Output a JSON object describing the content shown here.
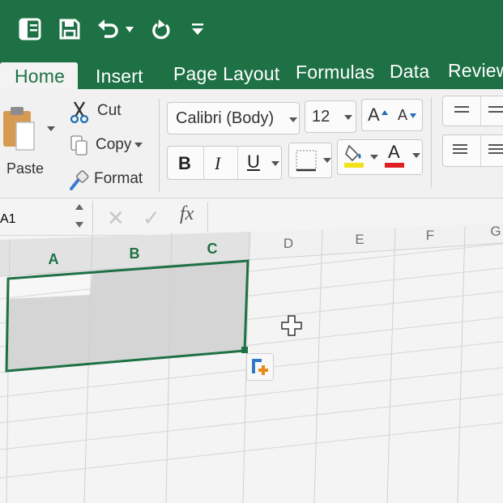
{
  "quick_access": {
    "icons": [
      "sidebar-toggle-icon",
      "save-icon",
      "undo-icon",
      "redo-icon",
      "customize-toolbar-icon"
    ]
  },
  "tabs": [
    {
      "label": "Home",
      "active": true
    },
    {
      "label": "Insert",
      "active": false
    },
    {
      "label": "Page Layout",
      "active": false
    },
    {
      "label": "Formulas",
      "active": false
    },
    {
      "label": "Data",
      "active": false
    },
    {
      "label": "Review",
      "active": false
    }
  ],
  "clipboard": {
    "paste": "Paste",
    "cut": "Cut",
    "copy": "Copy",
    "format": "Format"
  },
  "font": {
    "name": "Calibri (Body)",
    "size": "12",
    "increase": "A",
    "decrease": "A",
    "bold": "B",
    "italic": "I",
    "underline": "U",
    "font_color_letter": "A",
    "fill_color": "#f2e21a",
    "font_color": "#e02020"
  },
  "formula_bar": {
    "name_box": "A1",
    "fx": "fx",
    "value": ""
  },
  "grid": {
    "columns": [
      "A",
      "B",
      "C",
      "D",
      "E",
      "F",
      "G"
    ],
    "selected_columns": [
      "A",
      "B",
      "C"
    ],
    "selection": "A1:C4",
    "accent": "#1e7145"
  }
}
